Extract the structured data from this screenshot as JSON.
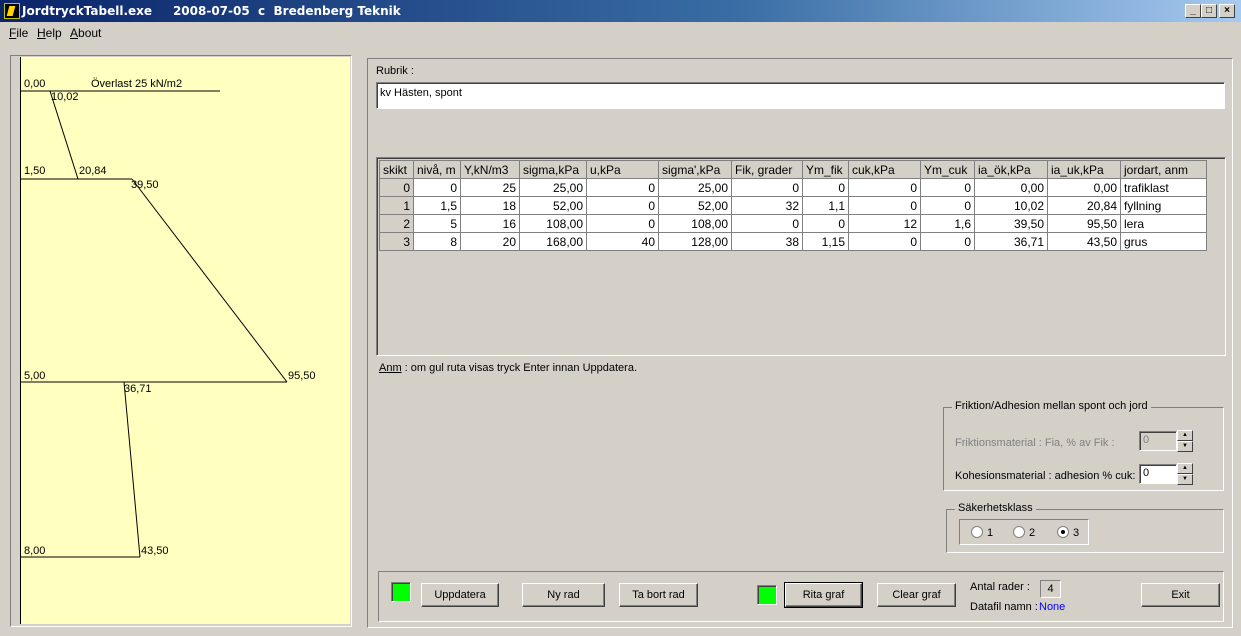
{
  "window": {
    "title": "JordtryckTabell.exe     2008-07-05  c  Bredenberg Teknik",
    "minimize": "_",
    "maximize": "□",
    "close": "×"
  },
  "menu": [
    "File",
    "Help",
    "About"
  ],
  "graph": {
    "labels": [
      "0,00",
      "Överlast 25 kN/m2",
      "10,02",
      "1,50",
      "20,84",
      "39,50",
      "5,00",
      "95,50",
      "36,71",
      "8,00",
      "43,50"
    ]
  },
  "rubrik": {
    "label": "Rubrik :",
    "value": "kv Hästen, spont"
  },
  "table": {
    "headers": [
      "skikt",
      "nivå, m",
      "Y,kN/m3",
      "sigma,kPa",
      "u,kPa",
      "sigma',kPa",
      "Fik, grader",
      "Ym_fik",
      "cuk,kPa",
      "Ym_cuk",
      "ia_ök,kPa",
      "ia_uk,kPa",
      "jordart, anm"
    ],
    "rows": [
      [
        "0",
        "0",
        "25",
        "25,00",
        "0",
        "25,00",
        "0",
        "0",
        "0",
        "0",
        "0,00",
        "0,00",
        "trafiklast"
      ],
      [
        "1",
        "1,5",
        "18",
        "52,00",
        "0",
        "52,00",
        "32",
        "1,1",
        "0",
        "0",
        "10,02",
        "20,84",
        "fyllning"
      ],
      [
        "2",
        "5",
        "16",
        "108,00",
        "0",
        "108,00",
        "0",
        "0",
        "12",
        "1,6",
        "39,50",
        "95,50",
        "lera"
      ],
      [
        "3",
        "8",
        "20",
        "168,00",
        "40",
        "128,00",
        "38",
        "1,15",
        "0",
        "0",
        "36,71",
        "43,50",
        "grus"
      ]
    ]
  },
  "note": {
    "anm": "Anm",
    "text": " : om gul ruta visas tryck Enter innan Uppdatera."
  },
  "friction": {
    "title": "Friktion/Adhesion mellan spont och jord",
    "friction_label": "Friktionsmaterial : Fia, % av Fik :",
    "friction_value": "0",
    "cohesion_label": "Kohesionsmaterial : adhesion % cuk:",
    "cohesion_value": "0"
  },
  "safety": {
    "title": "Säkerhetsklass",
    "options": [
      "1",
      "2",
      "3"
    ],
    "selected": "3"
  },
  "buttons": {
    "update": "Uppdatera",
    "new_row": "Ny rad",
    "delete_row": "Ta bort rad",
    "draw_graph": "Rita graf",
    "clear_graph": "Clear graf",
    "exit": "Exit"
  },
  "status": {
    "rows_label": "Antal rader :",
    "rows_value": "4",
    "file_label": "Datafil namn :",
    "file_value": "None"
  },
  "colors": {
    "graph_bg": "#ffffc0",
    "indicator": "#00ff00",
    "title_bar": "#0a246a",
    "file_value": "#0000ff"
  }
}
